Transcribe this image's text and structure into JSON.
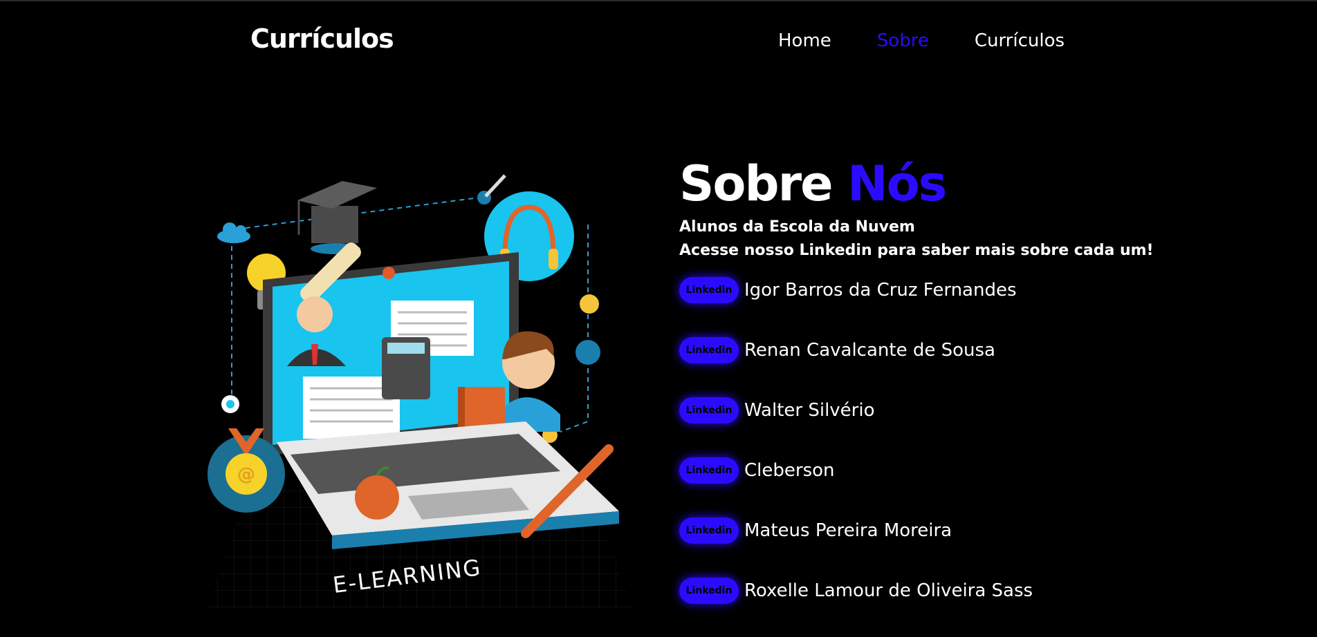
{
  "brand": "Currículos",
  "nav": {
    "items": [
      "Home",
      "Sobre",
      "Currículos"
    ],
    "active": "Sobre"
  },
  "illustration": {
    "caption": "E-LEARNING"
  },
  "about": {
    "title_main": "Sobre",
    "title_accent": "Nós",
    "subtitle_1": "Alunos da Escola da Nuvem",
    "subtitle_2": "Acesse nosso Linkedin para saber mais sobre cada um!",
    "badge_label": "Linkedin",
    "members": [
      "Igor Barros da Cruz Fernandes",
      "Renan Cavalcante de Sousa",
      "Walter Silvério",
      "Cleberson",
      "Mateus Pereira Moreira",
      "Roxelle Lamour de Oliveira Sass"
    ]
  },
  "colors": {
    "accent": "#2b0bff",
    "background": "#000000",
    "text": "#ffffff"
  }
}
